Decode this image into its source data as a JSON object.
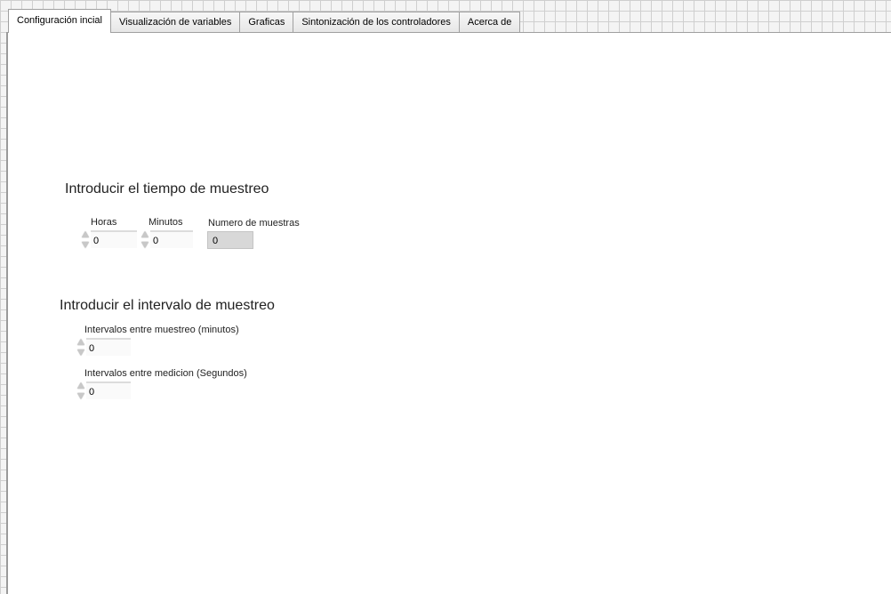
{
  "tabs": [
    {
      "label": "Configuración incial",
      "active": true
    },
    {
      "label": "Visualización de variables",
      "active": false
    },
    {
      "label": "Graficas",
      "active": false
    },
    {
      "label": "Sintonización de los controladores",
      "active": false
    },
    {
      "label": "Acerca de",
      "active": false
    }
  ],
  "sampling_time": {
    "heading": "Introducir el tiempo de muestreo",
    "hours_label": "Horas",
    "hours_value": "0",
    "minutes_label": "Minutos",
    "minutes_value": "0",
    "samples_label": "Numero de muestras",
    "samples_value": "0"
  },
  "sampling_interval": {
    "heading": "Introducir el intervalo de muestreo",
    "interval_minutes_label": "Intervalos entre muestreo (minutos)",
    "interval_minutes_value": "0",
    "interval_seconds_label": "Intervalos entre medicion (Segundos)",
    "interval_seconds_value": "0"
  },
  "icons": {
    "spinner_up": "increment-arrow-icon",
    "spinner_down": "decrement-arrow-icon"
  }
}
